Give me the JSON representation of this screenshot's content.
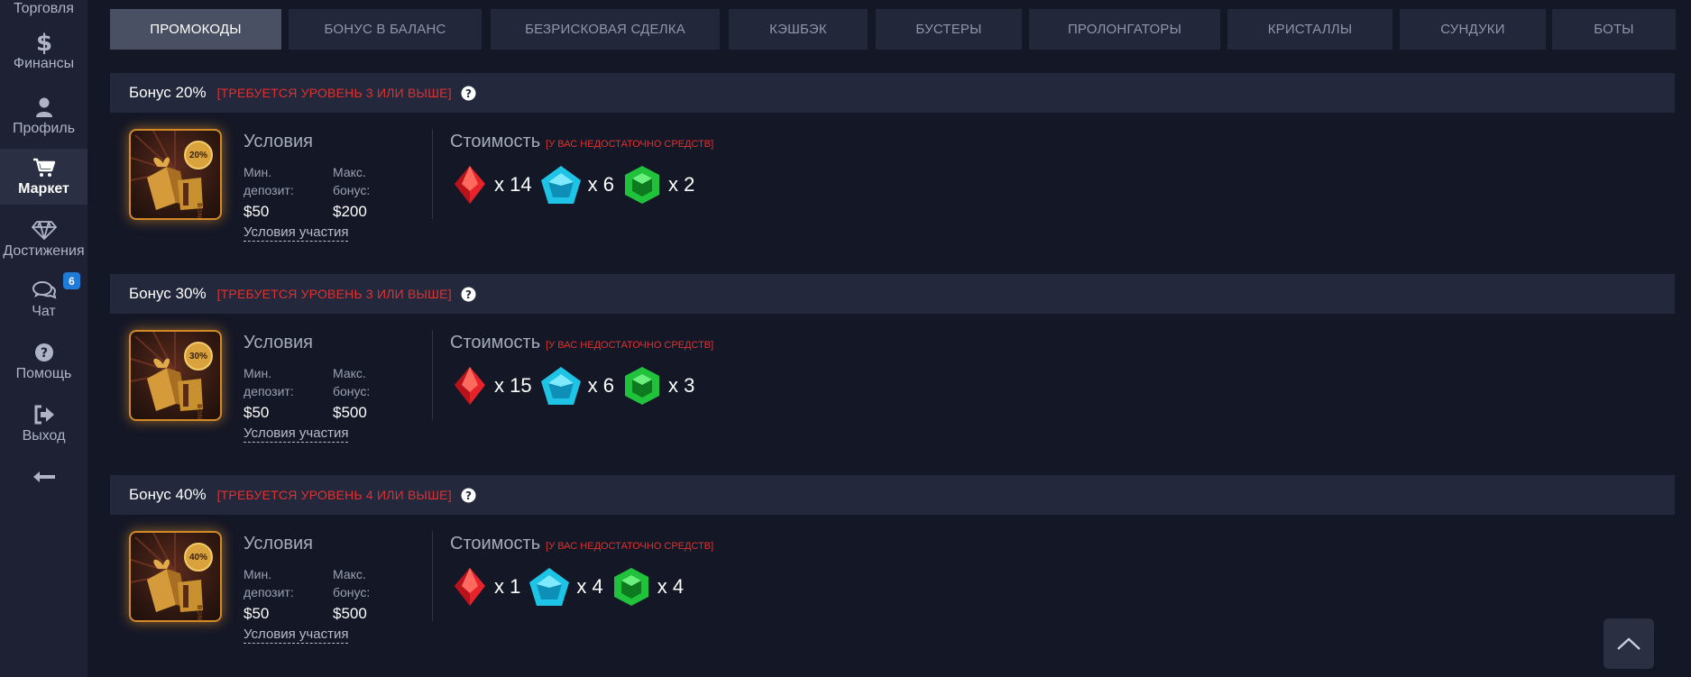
{
  "sidebar": {
    "items": [
      {
        "label": "Торговля",
        "icon": "trading-icon"
      },
      {
        "label": "Финансы",
        "icon": "dollar-icon"
      },
      {
        "label": "Профиль",
        "icon": "user-icon"
      },
      {
        "label": "Маркет",
        "icon": "cart-icon"
      },
      {
        "label": "Достижения",
        "icon": "diamond-icon"
      },
      {
        "label": "Чат",
        "icon": "chat-icon",
        "badge": "6"
      },
      {
        "label": "Помощь",
        "icon": "question-icon"
      },
      {
        "label": "Выход",
        "icon": "logout-icon"
      }
    ],
    "collapse_icon": "arrow-left-icon"
  },
  "tabs": [
    {
      "label": "ПРОМОКОДЫ",
      "active": true
    },
    {
      "label": "БОНУС В БАЛАНС"
    },
    {
      "label": "БЕЗРИСКОВАЯ СДЕЛКА"
    },
    {
      "label": "КЭШБЭК"
    },
    {
      "label": "БУСТЕРЫ"
    },
    {
      "label": "ПРОЛОНГАТОРЫ"
    },
    {
      "label": "КРИСТАЛЛЫ"
    },
    {
      "label": "СУНДУКИ"
    },
    {
      "label": "БОТЫ"
    }
  ],
  "offers": [
    {
      "title": "Бонус 20%",
      "requirement": "[ТРЕБУЕТСЯ УРОВЕНЬ 3 ИЛИ ВЫШЕ]",
      "image_badge": "20%",
      "conditions_title": "Условия",
      "min_label": "Мин. депозит:",
      "min_value": "$50",
      "max_label": "Макс. бонус:",
      "max_value": "$200",
      "conditions_link": "Условия участия",
      "cost_title": "Стоимость",
      "cost_warning": "[У ВАС НЕДОСТАТОЧНО СРЕДСТВ]",
      "gems": {
        "red": "x 14",
        "blue": "x 6",
        "green": "x 2"
      }
    },
    {
      "title": "Бонус 30%",
      "requirement": "[ТРЕБУЕТСЯ УРОВЕНЬ 3 ИЛИ ВЫШЕ]",
      "image_badge": "30%",
      "conditions_title": "Условия",
      "min_label": "Мин. депозит:",
      "min_value": "$50",
      "max_label": "Макс. бонус:",
      "max_value": "$500",
      "conditions_link": "Условия участия",
      "cost_title": "Стоимость",
      "cost_warning": "[У ВАС НЕДОСТАТОЧНО СРЕДСТВ]",
      "gems": {
        "red": "x 15",
        "blue": "x 6",
        "green": "x 3"
      }
    },
    {
      "title": "Бонус 40%",
      "requirement": "[ТРЕБУЕТСЯ УРОВЕНЬ 4 ИЛИ ВЫШЕ]",
      "image_badge": "40%",
      "conditions_title": "Условия",
      "min_label": "Мин. депозит:",
      "min_value": "$50",
      "max_label": "Макс. бонус:",
      "max_value": "$500",
      "conditions_link": "Условия участия",
      "cost_title": "Стоимость",
      "cost_warning": "[У ВАС НЕДОСТАТОЧНО СРЕДСТВ]",
      "gems": {
        "red": "x 1",
        "blue": "x 4",
        "green": "x 4"
      }
    }
  ],
  "colors": {
    "accent_red": "#e0312f",
    "badge_blue": "#1f7ad8",
    "gem_red": "#e8222a",
    "gem_blue": "#1ec4e6",
    "gem_green": "#1fc23a"
  }
}
